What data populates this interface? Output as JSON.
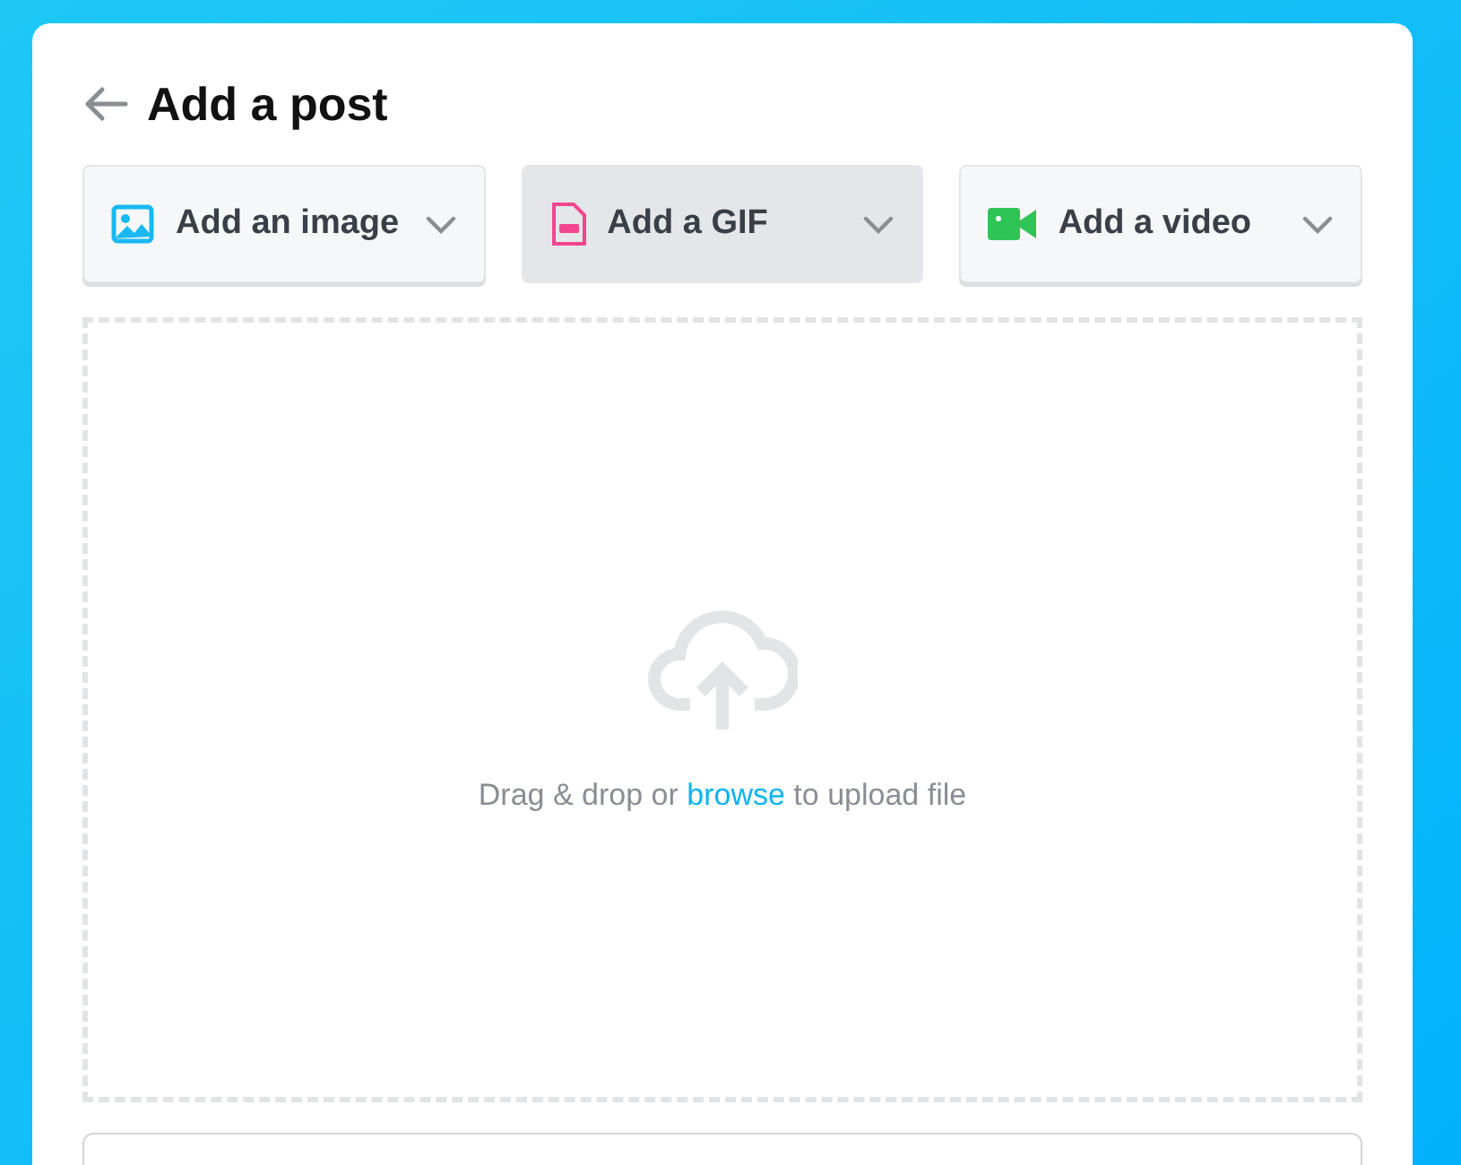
{
  "title": "Add a post",
  "tabs": [
    {
      "label": "Add an image",
      "kind": "image",
      "selected": false
    },
    {
      "label": "Add a GIF",
      "kind": "gif",
      "selected": true
    },
    {
      "label": "Add a video",
      "kind": "video",
      "selected": false
    }
  ],
  "dropzone": {
    "text_before": "Drag & drop or",
    "link": "browse",
    "text_after": "to upload file"
  }
}
